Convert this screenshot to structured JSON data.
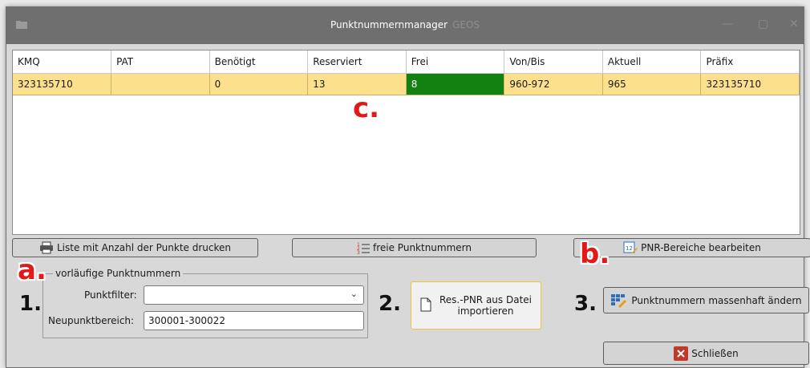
{
  "window": {
    "title": "Punktnummernmanager",
    "title_suffix": "GEOS"
  },
  "grid": {
    "columns": [
      "KMQ",
      "PAT",
      "Benötigt",
      "Reserviert",
      "Frei",
      "Von/Bis",
      "Aktuell",
      "Präfix"
    ],
    "rows": [
      [
        "323135710",
        "",
        "0",
        "13",
        "8",
        "960-972",
        "965",
        "323135710"
      ]
    ]
  },
  "buttons": {
    "print_list": "Liste mit Anzahl der Punkte drucken",
    "free_numbers": "freie Punktnummern",
    "edit_ranges": "PNR-Bereiche bearbeiten",
    "import_line1": "Res.-PNR aus Datei",
    "import_line2": "importieren",
    "mass_change": "Punktnummern massenhaft ändern",
    "close": "Schließen"
  },
  "group": {
    "legend": "vorläufige Punktnummern",
    "filter_label": "Punktfilter:",
    "filter_value": "",
    "range_label": "Neupunktbereich:",
    "range_value": "300001-300022"
  },
  "annotations": {
    "a": "a.",
    "b": "b.",
    "c": "c.",
    "n1": "1.",
    "n2": "2.",
    "n3": "3."
  },
  "colors": {
    "row_highlight": "#fde08b",
    "free_cell": "#138012",
    "annotation_red": "#e11919",
    "import_border": "#f0c040",
    "close_icon": "#c0392b"
  }
}
